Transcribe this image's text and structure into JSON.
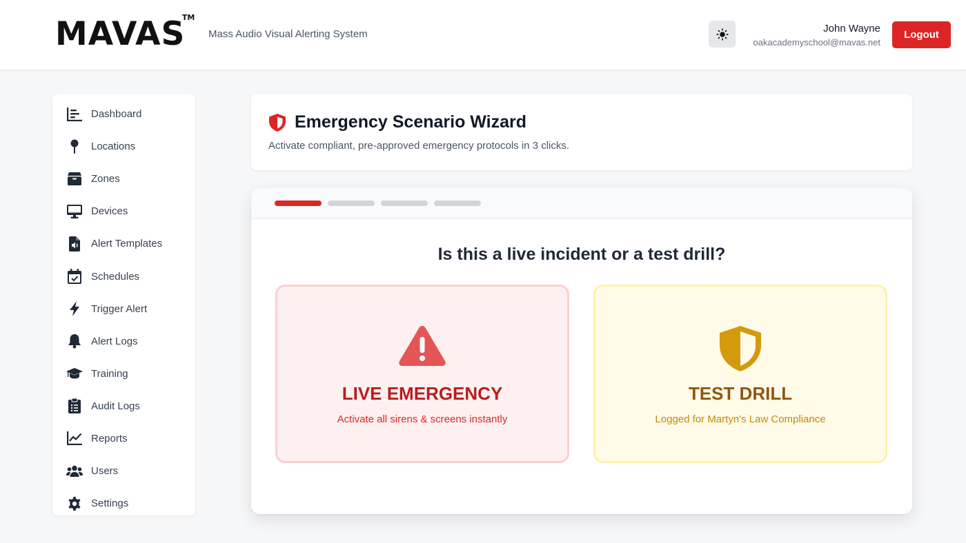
{
  "header": {
    "logo_text": "MAVAS",
    "logo_tm": "TM",
    "tagline": "Mass Audio Visual Alerting System",
    "theme_toggle_icon": "sun-icon",
    "user_name": "John Wayne",
    "user_email": "oakacademyschool@mavas.net",
    "logout_label": "Logout"
  },
  "sidebar": {
    "items": [
      {
        "label": "Dashboard",
        "icon": "dashboard-icon"
      },
      {
        "label": "Locations",
        "icon": "map-pin-icon"
      },
      {
        "label": "Zones",
        "icon": "box-icon"
      },
      {
        "label": "Devices",
        "icon": "monitor-icon"
      },
      {
        "label": "Alert Templates",
        "icon": "audio-file-icon"
      },
      {
        "label": "Schedules",
        "icon": "calendar-check-icon"
      },
      {
        "label": "Trigger Alert",
        "icon": "bolt-icon"
      },
      {
        "label": "Alert Logs",
        "icon": "bell-icon"
      },
      {
        "label": "Training",
        "icon": "graduation-cap-icon"
      },
      {
        "label": "Audit Logs",
        "icon": "clipboard-list-icon"
      },
      {
        "label": "Reports",
        "icon": "line-chart-icon"
      },
      {
        "label": "Users",
        "icon": "users-icon"
      },
      {
        "label": "Settings",
        "icon": "gear-icon"
      }
    ]
  },
  "wizard": {
    "title": "Emergency Scenario Wizard",
    "subtitle": "Activate compliant, pre-approved emergency protocols in 3 clicks.",
    "steps_total": 4,
    "current_step": 1,
    "question": "Is this a live incident or a test drill?",
    "options": {
      "live": {
        "title": "LIVE EMERGENCY",
        "description": "Activate all sirens & screens instantly",
        "icon": "warning-triangle-icon"
      },
      "drill": {
        "title": "TEST DRILL",
        "description": "Logged for Martyn's Law Compliance",
        "icon": "half-shield-icon"
      }
    }
  },
  "colors": {
    "accent": "#dc2626",
    "live_bg": "#fef0f0",
    "drill_bg": "#fffbe8",
    "drill_accent": "#92560e",
    "step_inactive": "#d1d5db"
  }
}
